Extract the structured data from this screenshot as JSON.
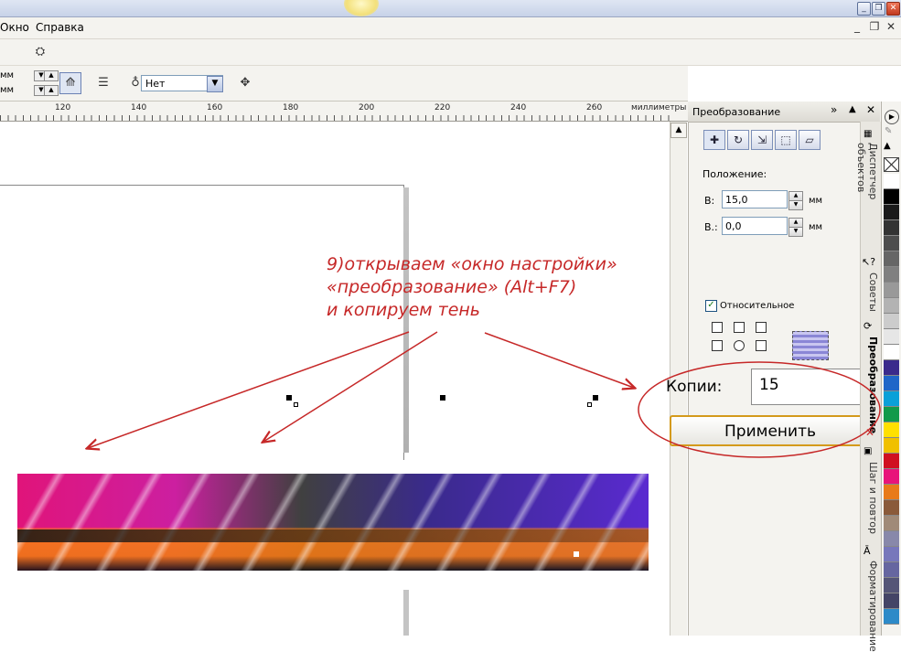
{
  "menubar": {
    "items": [
      "Окно",
      "Справка"
    ]
  },
  "toolbar": {
    "unit_1": "мм",
    "unit_2": "мм",
    "outline_combo_value": "Нет"
  },
  "ruler": {
    "labels": [
      "120",
      "140",
      "160",
      "180",
      "200",
      "220",
      "240",
      "260"
    ],
    "unit_label": "миллиметры"
  },
  "docker": {
    "title": "Преобразование",
    "position_label": "Положение:",
    "h_label": "В:",
    "h_value": "15,0",
    "h_unit": "мм",
    "v_label": "В.:",
    "v_value": "0,0",
    "v_unit": "мм",
    "relative_label": "Относительное",
    "copies_label": "Копии:",
    "copies_value": "15",
    "apply_label": "Применить"
  },
  "side_tabs": [
    "Диспетчер объектов",
    "Советы",
    "Преобразование",
    "Шаг и повтор",
    "Форматирование"
  ],
  "annotation": {
    "line1": "9)открываем «окно настройки»",
    "line2": "«преобразование» (Alt+F7)",
    "line3": "и копируем тень"
  },
  "colors": {
    "accent_annotation": "#c62828",
    "apply_border": "#d49a1b"
  },
  "palette": [
    "#ffffff",
    "#000000",
    "#1a1a1a",
    "#333333",
    "#4d4d4d",
    "#666666",
    "#808080",
    "#999999",
    "#b3b3b3",
    "#cccccc",
    "#e6e6e6",
    "#ffffff",
    "#3a2a8c",
    "#1f66c8",
    "#0aa0d8",
    "#119a4a",
    "#ffe000",
    "#f0c000",
    "#d01020",
    "#e8147a",
    "#e87a1a",
    "#8a5a3a",
    "#a08a78",
    "#8888aa",
    "#7777bb",
    "#6666a0",
    "#555577",
    "#444466",
    "#2d8ac8"
  ]
}
